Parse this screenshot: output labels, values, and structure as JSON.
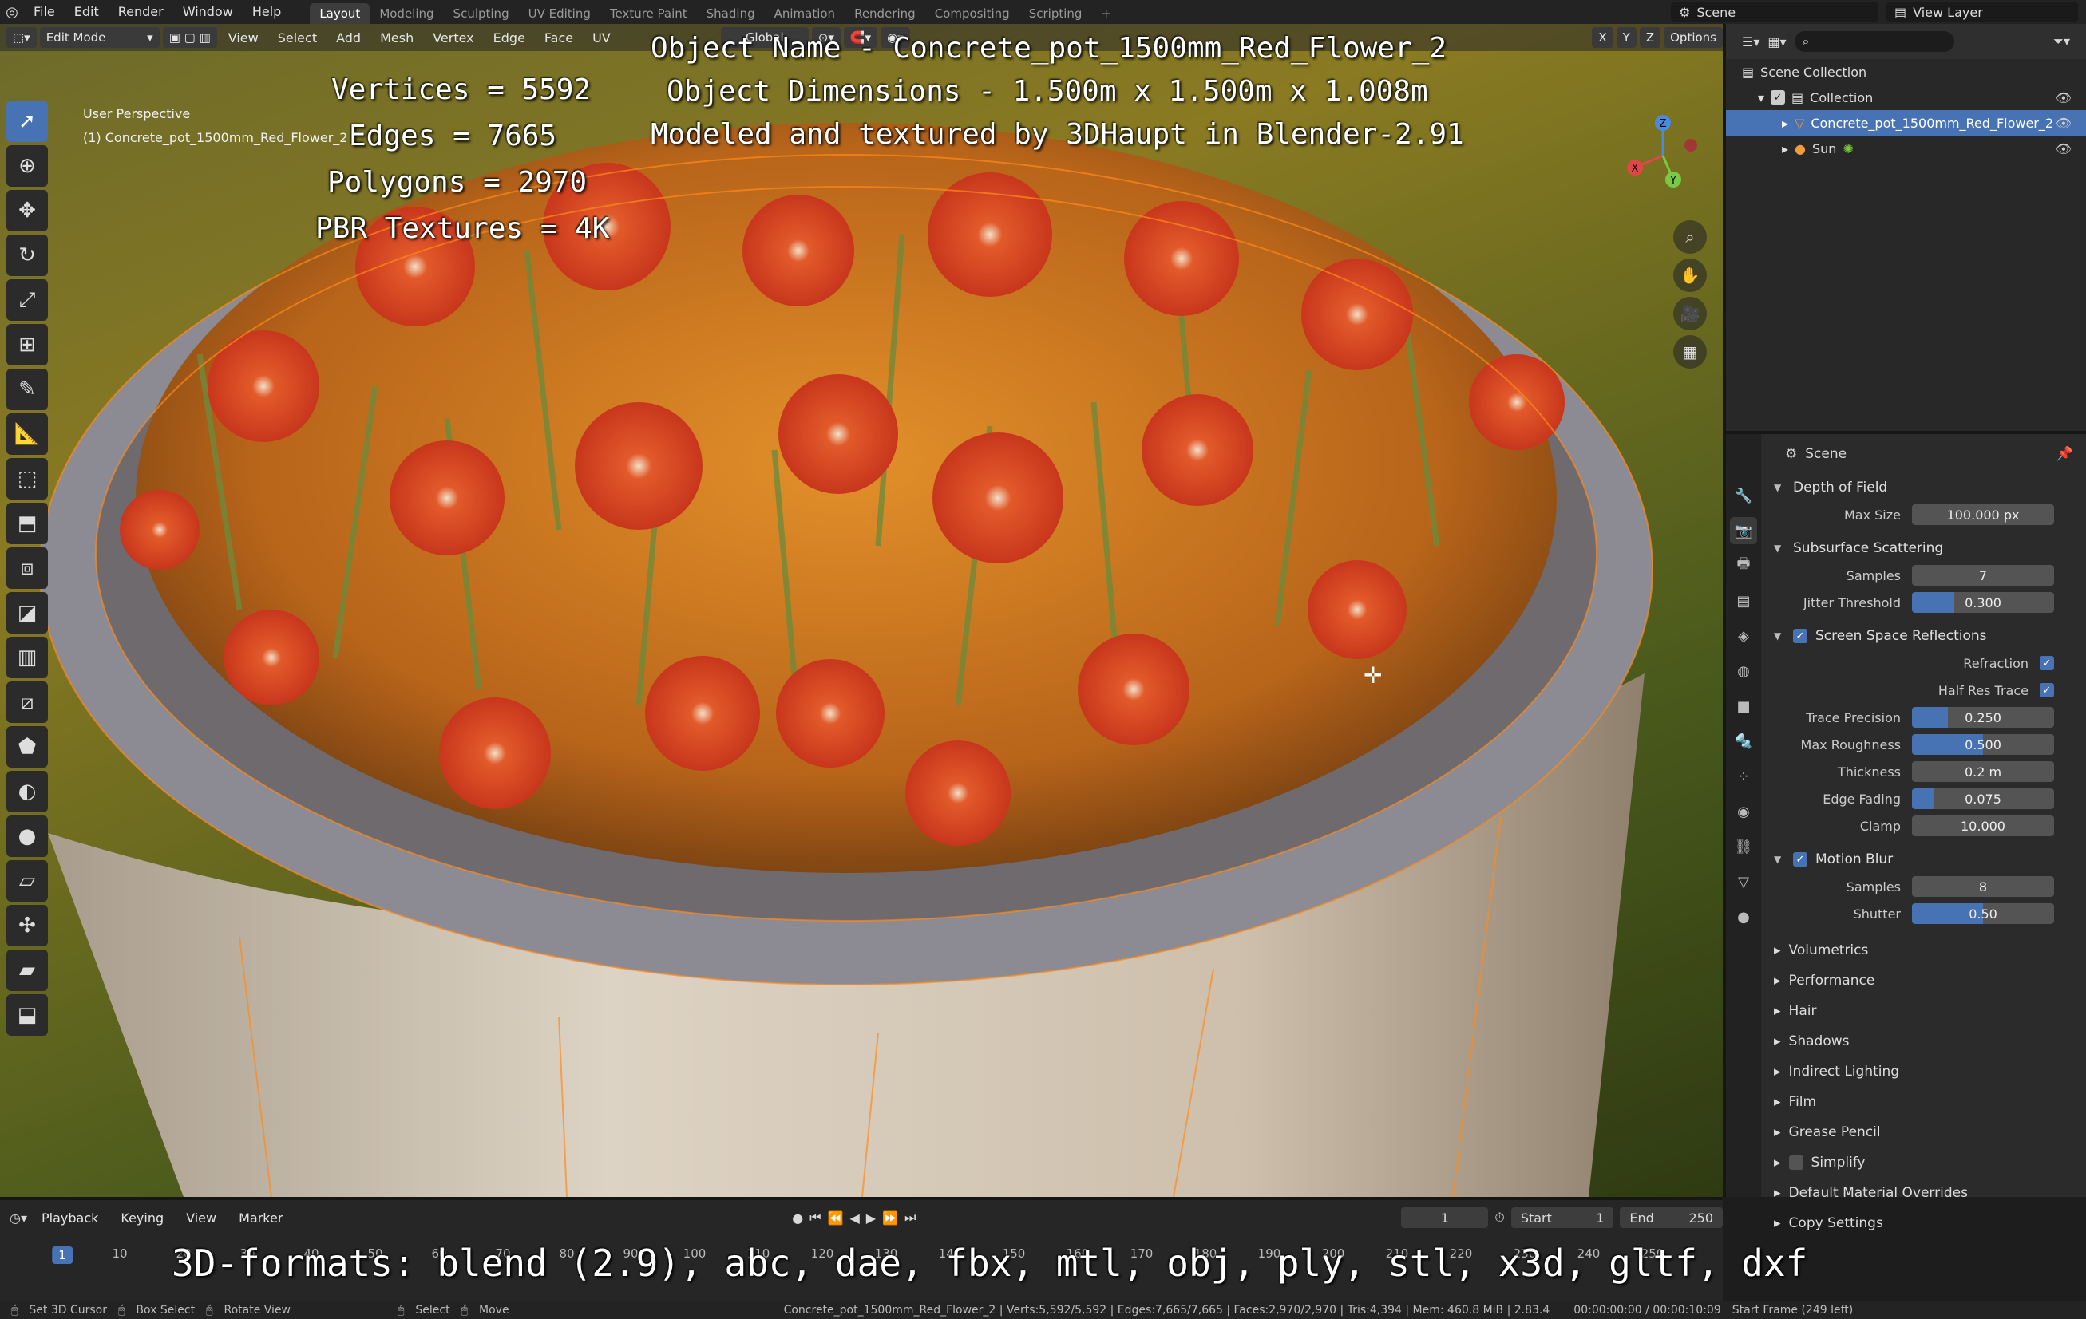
{
  "menu": {
    "items": [
      "File",
      "Edit",
      "Render",
      "Window",
      "Help"
    ],
    "workspaces": [
      "Layout",
      "Modeling",
      "Sculpting",
      "UV Editing",
      "Texture Paint",
      "Shading",
      "Animation",
      "Rendering",
      "Compositing",
      "Scripting"
    ],
    "active_workspace": "Layout",
    "add_tab": "+",
    "scene": "Scene",
    "view_layer": "View Layer"
  },
  "viewport_header": {
    "mode": "Edit Mode",
    "menus": [
      "View",
      "Select",
      "Add",
      "Mesh",
      "Vertex",
      "Edge",
      "Face",
      "UV"
    ],
    "orientation": "Global",
    "axes": [
      "X",
      "Y",
      "Z"
    ],
    "options": "Options"
  },
  "viewport_info": {
    "perspective": "User Perspective",
    "object": "(1) Concrete_pot_1500mm_Red_Flower_2"
  },
  "overlay": {
    "object_name": "Object Name - Concrete_pot_1500mm_Red_Flower_2",
    "dimensions": "Object Dimensions -  1.500m x 1.500m x 1.008m",
    "credit": "Modeled and textured by 3DHaupt in Blender-2.91",
    "vertices": "Vertices = 5592",
    "edges": "Edges = 7665",
    "polygons": "Polygons = 2970",
    "textures": "PBR Textures = 4K",
    "formats": "3D-formats: blend (2.9), abc, dae, fbx, mtl, obj, ply, stl, x3d, gltf, dxf"
  },
  "gizmo": {
    "x": "X",
    "y": "Y",
    "z": "Z"
  },
  "outliner": {
    "scene_collection": "Scene Collection",
    "collection": "Collection",
    "object": "Concrete_pot_1500mm_Red_Flower_2",
    "sun": "Sun"
  },
  "properties": {
    "context": "Scene",
    "dof": {
      "title": "Depth of Field",
      "max_size_label": "Max Size",
      "max_size": "100.000 px"
    },
    "sss": {
      "title": "Subsurface Scattering",
      "samples_label": "Samples",
      "samples": "7",
      "jitter_label": "Jitter Threshold",
      "jitter": "0.300",
      "jitter_frac": 0.3
    },
    "ssr": {
      "title": "Screen Space Reflections",
      "refraction": "Refraction",
      "half_res": "Half Res Trace",
      "trace_label": "Trace Precision",
      "trace": "0.250",
      "trace_frac": 0.25,
      "rough_label": "Max Roughness",
      "rough": "0.500",
      "rough_frac": 0.5,
      "thick_label": "Thickness",
      "thick": "0.2 m",
      "fade_label": "Edge Fading",
      "fade": "0.075",
      "fade_frac": 0.15,
      "clamp_label": "Clamp",
      "clamp": "10.000"
    },
    "motion_blur": {
      "title": "Motion Blur",
      "samples_label": "Samples",
      "samples": "8",
      "shutter_label": "Shutter",
      "shutter": "0.50",
      "shutter_frac": 0.5
    },
    "collapsed": [
      "Volumetrics",
      "Performance",
      "Hair",
      "Shadows",
      "Indirect Lighting",
      "Film",
      "Grease Pencil",
      "Simplify",
      "Default Material Overrides",
      "Copy Settings"
    ]
  },
  "timeline": {
    "menus": [
      "Playback",
      "Keying",
      "View",
      "Marker"
    ],
    "current_frame": "1",
    "start_label": "Start",
    "start": "1",
    "end_label": "End",
    "end": "250",
    "ruler": [
      "1",
      "10",
      "20",
      "30",
      "40",
      "50",
      "60",
      "70",
      "80",
      "90",
      "100",
      "110",
      "120",
      "130",
      "140",
      "150",
      "160",
      "170",
      "180",
      "190",
      "200",
      "210",
      "220",
      "230",
      "240",
      "250"
    ]
  },
  "statusbar": {
    "set_cursor": "Set 3D Cursor",
    "box_select": "Box Select",
    "rotate": "Rotate View",
    "select": "Select",
    "move": "Move",
    "stats": "Concrete_pot_1500mm_Red_Flower_2 | Verts:5,592/5,592 | Edges:7,665/7,665 | Faces:2,970/2,970 | Tris:4,394 | Mem: 460.8 MiB | 2.83.4",
    "time": "00:00:00:00 / 00:00:10:09",
    "start_frame": "Start Frame (249 left)"
  }
}
